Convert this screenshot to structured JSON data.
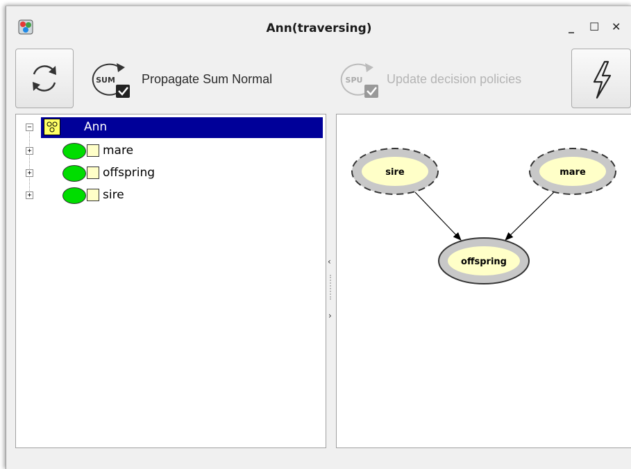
{
  "window": {
    "title": "Ann(traversing)",
    "controls": {
      "minimize": "_",
      "maximize": "☐",
      "close": "✕"
    }
  },
  "toolbar": {
    "refresh_icon": "refresh-icon",
    "propagate_icon_text": "SUM",
    "propagate_label": "Propagate Sum Normal",
    "update_icon_text": "SPU",
    "update_label": "Update decision policies",
    "flash_icon": "lightning-icon"
  },
  "tree": {
    "root": {
      "label": "Ann",
      "expander": "−"
    },
    "nodes": [
      {
        "label": "mare",
        "expander": "+"
      },
      {
        "label": "offspring",
        "expander": "+"
      },
      {
        "label": "sire",
        "expander": "+"
      }
    ]
  },
  "graph": {
    "nodes": [
      {
        "id": "sire",
        "label": "sire"
      },
      {
        "id": "mare",
        "label": "mare"
      },
      {
        "id": "offspring",
        "label": "offspring"
      }
    ],
    "edges": [
      {
        "from": "sire",
        "to": "offspring"
      },
      {
        "from": "mare",
        "to": "offspring"
      }
    ]
  },
  "colors": {
    "selection": "#000099",
    "node_fill": "#ffffc8",
    "node_ring": "#c8c8c8",
    "status_green": "#00dd00"
  }
}
